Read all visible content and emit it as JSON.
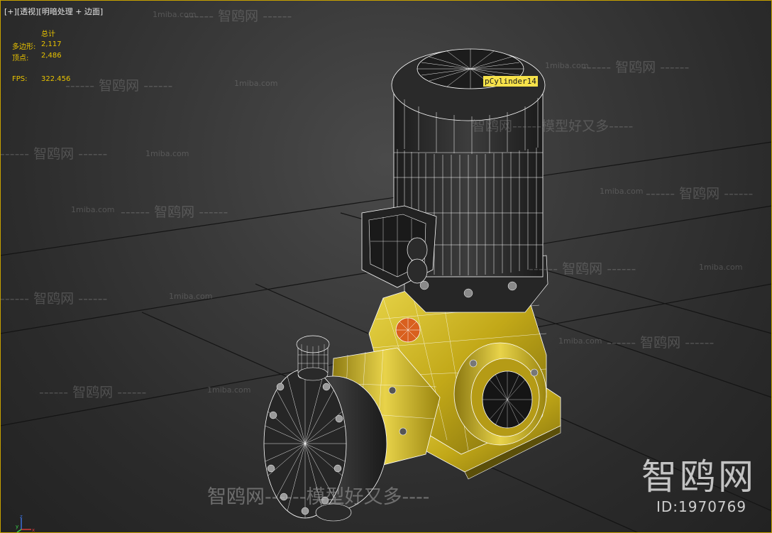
{
  "viewport": {
    "label_plus": "[+]",
    "label_view": "[透视]",
    "label_shading": "[明暗处理 + 边面]"
  },
  "stats": {
    "total_label": "总计",
    "polygons_label": "多边形:",
    "polygons_value": "2,117",
    "vertices_label": "顶点:",
    "vertices_value": "2,486",
    "fps_label": "FPS:",
    "fps_value": "322.456"
  },
  "selected_object": "pCylinder14",
  "watermarks": {
    "line1": "------ 智鸥网 ------",
    "line2": "智鸥网------模型好又多-----",
    "site": "1miba.com",
    "bottom": "智鸥网------模型好又多----",
    "brand": "智鸥网",
    "brand_id": "ID:1970769"
  },
  "axis": {
    "x": "x",
    "y": "y",
    "z": "z"
  },
  "colors": {
    "viewport_border": "#c7a100",
    "stats_text": "#e8c200",
    "pump_body": "#c9b21a",
    "motor": "#2a2a2a",
    "wire": "#ffffff",
    "selection_label_bg": "#f6e24a"
  }
}
